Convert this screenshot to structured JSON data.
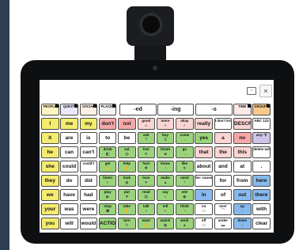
{
  "toolbar": {
    "message_icon": "speech-icon",
    "close_label": "×"
  },
  "suffix_buttons": [
    "-ed",
    "-ing",
    "-s"
  ],
  "colors": {
    "yellow": "#f4ec6e",
    "green": "#9ad37a",
    "blue": "#87b9ec",
    "pink": "#f6a8a9",
    "lightpink": "#f9d4d2",
    "purple": "#cfc3e8",
    "orange": "#f7c98a",
    "white": "#ffffff"
  },
  "folders": [
    {
      "label": "PEOPLE",
      "color": "#fff5c2"
    },
    {
      "label": "QUESTI",
      "color": "#eae8ff"
    },
    {
      "label": "SOCIAL",
      "color": "#fff0e6"
    },
    {
      "label": "PLACES",
      "color": "#f2f2f2"
    }
  ],
  "top_right_folders": [
    {
      "label": "TIME",
      "color": "#fde8e8"
    },
    {
      "label": "GROUPS",
      "color": "#f7c98a"
    }
  ],
  "rows": [
    [
      {
        "t": "I",
        "c": "yellow"
      },
      {
        "t": "me",
        "c": "yellow"
      },
      {
        "t": "my",
        "c": "yellow"
      },
      {
        "t": "don't",
        "c": "pink"
      },
      {
        "t": "not",
        "c": "pink"
      },
      {
        "t": "good",
        "c": "lightpink",
        "i": "☺"
      },
      {
        "t": "more",
        "c": "lightpink",
        "i": "+"
      },
      {
        "t": "okay",
        "c": "lightpink",
        "i": "✓"
      },
      {
        "t": "really",
        "c": "lightpink"
      },
      {
        "t": "I don't know",
        "c": "white"
      },
      {
        "t": "DESCRI",
        "c": "lightpink"
      },
      {
        "t": "ABC 123",
        "c": "white"
      }
    ],
    [
      {
        "t": "it",
        "c": "yellow"
      },
      {
        "t": "are",
        "c": "white"
      },
      {
        "t": "is",
        "c": "white"
      },
      {
        "t": "to",
        "c": "white"
      },
      {
        "t": "be",
        "c": "white"
      },
      {
        "t": "ask",
        "c": "green",
        "i": "?"
      },
      {
        "t": "buy",
        "c": "green",
        "i": "$"
      },
      {
        "t": "come",
        "c": "green",
        "i": "→"
      },
      {
        "t": "yes",
        "c": "green"
      },
      {
        "t": "a",
        "c": "lightpink"
      },
      {
        "t": "no",
        "c": "pink"
      },
      {
        "t": "any- ∀",
        "c": "purple"
      }
    ],
    [
      {
        "t": "he",
        "c": "yellow"
      },
      {
        "t": "can",
        "c": "white"
      },
      {
        "t": "can't",
        "c": "white"
      },
      {
        "t": "drink",
        "c": "green",
        "i": "◧"
      },
      {
        "t": "eat",
        "c": "green",
        "i": "◍"
      },
      {
        "t": "feel",
        "c": "green",
        "i": "♥"
      },
      {
        "t": "finish",
        "c": "green",
        "i": "■"
      },
      {
        "t": "go",
        "c": "green",
        "i": "→"
      },
      {
        "t": "that",
        "c": "lightpink"
      },
      {
        "t": "the",
        "c": "lightpink"
      },
      {
        "t": "this",
        "c": "lightpink"
      },
      {
        "t": "delete wd",
        "c": "white"
      }
    ],
    [
      {
        "t": "she",
        "c": "yellow"
      },
      {
        "t": "could",
        "c": "white"
      },
      {
        "t": "could't",
        "c": "white"
      },
      {
        "t": "get",
        "c": "green",
        "i": "✋"
      },
      {
        "t": "help",
        "c": "green",
        "i": "✋"
      },
      {
        "t": "hurt",
        "c": "green",
        "i": "✱"
      },
      {
        "t": "know",
        "c": "green",
        "i": "◔"
      },
      {
        "t": "like",
        "c": "green",
        "i": "♥"
      },
      {
        "t": "about",
        "c": "white"
      },
      {
        "t": "and",
        "c": "white"
      },
      {
        "t": "at",
        "c": "white"
      },
      {
        "t": ".",
        "c": "white"
      }
    ],
    [
      {
        "t": "they",
        "c": "yellow"
      },
      {
        "t": "do",
        "c": "white"
      },
      {
        "t": "did",
        "c": "white"
      },
      {
        "t": "listen",
        "c": "green",
        "i": "◐"
      },
      {
        "t": "look",
        "c": "green",
        "i": "◉"
      },
      {
        "t": "love",
        "c": "green",
        "i": "♥"
      },
      {
        "t": "make",
        "c": "green",
        "i": "▲"
      },
      {
        "t": "need",
        "c": "green",
        "i": "!"
      },
      {
        "t": "be- cause",
        "c": "white"
      },
      {
        "t": "for",
        "c": "white"
      },
      {
        "t": "from",
        "c": "white"
      },
      {
        "t": "here",
        "c": "blue"
      }
    ],
    [
      {
        "t": "we",
        "c": "yellow"
      },
      {
        "t": "have",
        "c": "white"
      },
      {
        "t": "had",
        "c": "white"
      },
      {
        "t": "play",
        "c": "green",
        "i": "▶"
      },
      {
        "t": "put",
        "c": "green",
        "i": "▼"
      },
      {
        "t": "read",
        "c": "green",
        "i": "▤"
      },
      {
        "t": "say",
        "c": "green",
        "i": "◗"
      },
      {
        "t": "see",
        "c": "green",
        "i": "◉"
      },
      {
        "t": "in",
        "c": "blue"
      },
      {
        "t": "of",
        "c": "white"
      },
      {
        "t": "out",
        "c": "blue"
      },
      {
        "t": "there",
        "c": "blue"
      }
    ],
    [
      {
        "t": "your",
        "c": "yellow"
      },
      {
        "t": "was",
        "c": "white"
      },
      {
        "t": "were",
        "c": "white"
      },
      {
        "t": "stop",
        "c": "green",
        "i": "⬢"
      },
      {
        "t": "take",
        "c": "green",
        "i": "✋"
      },
      {
        "t": "talk",
        "c": "green",
        "i": "◗"
      },
      {
        "t": "tell",
        "c": "green",
        "i": "◗"
      },
      {
        "t": "think",
        "c": "green",
        "i": "◔"
      },
      {
        "t": "on",
        "c": "white",
        "i": "▭"
      },
      {
        "t": "over",
        "c": "white",
        "i": "⌒"
      },
      {
        "t": "up",
        "c": "blue",
        "i": "↑"
      },
      {
        "t": "with",
        "c": "white"
      }
    ],
    [
      {
        "t": "you",
        "c": "yellow"
      },
      {
        "t": "will",
        "c": "white"
      },
      {
        "t": "would",
        "c": "white"
      },
      {
        "t": "ACTION",
        "c": "green"
      },
      {
        "t": "turn",
        "c": "green",
        "i": "↻"
      },
      {
        "t": "want",
        "c": "green",
        "i": "✋"
      },
      {
        "t": "watch",
        "c": "green",
        "i": "◉"
      },
      {
        "t": "work",
        "c": "green",
        "i": "▲"
      },
      {
        "t": "off",
        "c": "white",
        "i": "▭"
      },
      {
        "t": "under",
        "c": "white",
        "i": "▬"
      },
      {
        "t": "down",
        "c": "blue",
        "i": "↓"
      },
      {
        "t": "clear",
        "c": "white"
      }
    ]
  ]
}
